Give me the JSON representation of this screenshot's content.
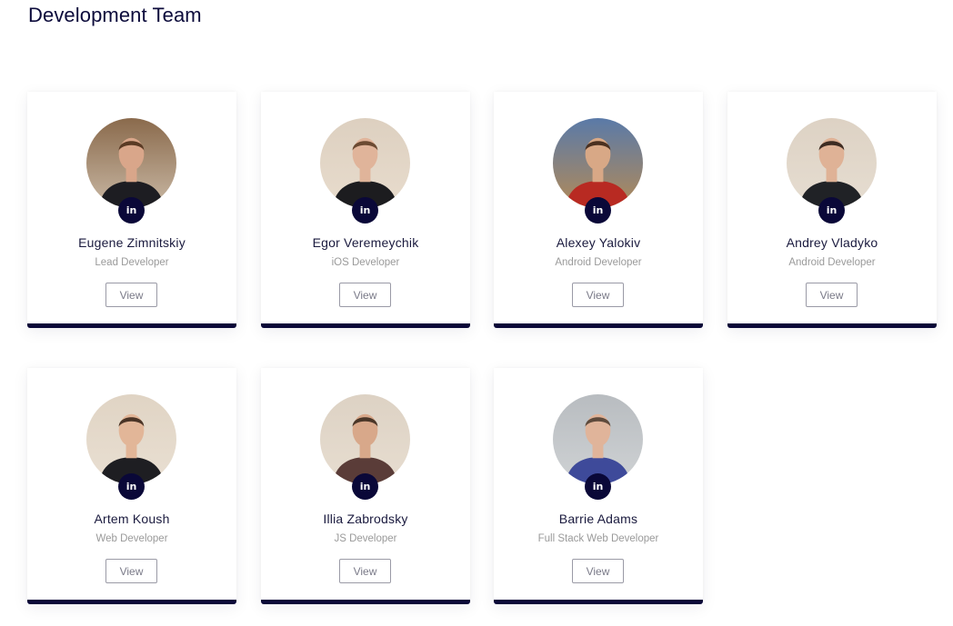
{
  "page": {
    "title": "Development Team"
  },
  "accent_color": "#0a0838",
  "team": [
    {
      "name": "Eugene Zimnitskiy",
      "role": "Lead Developer",
      "social_label": "in",
      "view_label": "View",
      "photo": {
        "bg": "#8a6a4c",
        "bg2": "#c9b8a4",
        "skin": "#d9a68a",
        "hair": "#5a3a24",
        "shirt": "#1d1d22"
      }
    },
    {
      "name": "Egor Veremeychik",
      "role": "iOS Developer",
      "social_label": "in",
      "view_label": "View",
      "photo": {
        "bg": "#ddd0c0",
        "bg2": "#e8dccd",
        "skin": "#e0b49a",
        "hair": "#6b4a32",
        "shirt": "#1c1c1f"
      }
    },
    {
      "name": "Alexey Yalokiv",
      "role": "Android Developer",
      "social_label": "in",
      "view_label": "View",
      "photo": {
        "bg": "#5a7aa8",
        "bg2": "#b28a58",
        "skin": "#d8a886",
        "hair": "#4a3020",
        "shirt": "#b82a22"
      }
    },
    {
      "name": "Andrey Vladyko",
      "role": "Android Developer",
      "social_label": "in",
      "view_label": "View",
      "photo": {
        "bg": "#ddd2c4",
        "bg2": "#e6ddd1",
        "skin": "#dfb296",
        "hair": "#3e2c22",
        "shirt": "#202226"
      }
    },
    {
      "name": "Artem Koush",
      "role": "Web Developer",
      "social_label": "in",
      "view_label": "View",
      "photo": {
        "bg": "#e0d4c4",
        "bg2": "#e9dfd2",
        "skin": "#e2b698",
        "hair": "#4a3426",
        "shirt": "#1e1e22"
      }
    },
    {
      "name": "Illia Zabrodsky",
      "role": "JS Developer",
      "social_label": "in",
      "view_label": "View",
      "photo": {
        "bg": "#ddd2c4",
        "bg2": "#e7ddd0",
        "skin": "#d8a88a",
        "hair": "#4a3628",
        "shirt": "#5a3c38"
      }
    },
    {
      "name": "Barrie Adams",
      "role": "Full Stack Web Developer",
      "social_label": "in",
      "view_label": "View",
      "photo": {
        "bg": "#b8bcc0",
        "bg2": "#cfd2d4",
        "skin": "#e0b49a",
        "hair": "#5e4a3c",
        "shirt": "#3e4a9a"
      }
    }
  ]
}
